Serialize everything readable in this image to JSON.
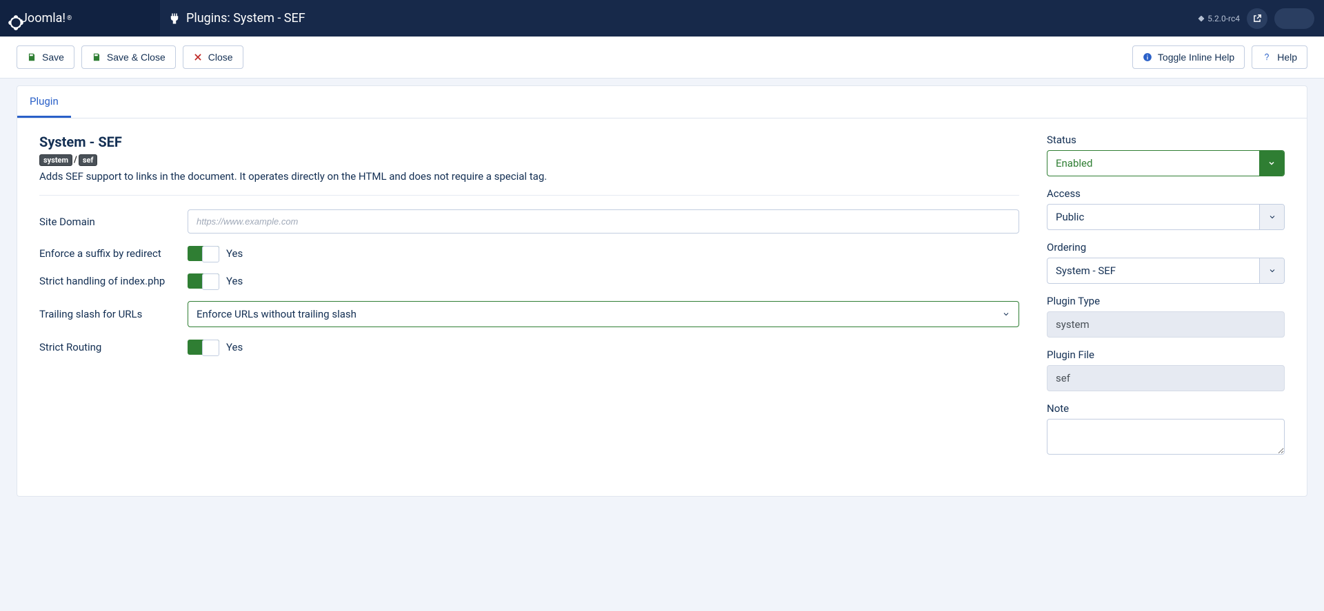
{
  "brand": "Joomla!",
  "page_title": "Plugins: System - SEF",
  "version": "5.2.0-rc4",
  "toolbar": {
    "save": "Save",
    "save_close": "Save & Close",
    "close": "Close",
    "toggle_help": "Toggle Inline Help",
    "help": "Help"
  },
  "tab": "Plugin",
  "plugin": {
    "title": "System - SEF",
    "badge_group": "system",
    "badge_element": "sef",
    "description": "Adds SEF support to links in the document. It operates directly on the HTML and does not require a special tag."
  },
  "fields": {
    "site_domain_label": "Site Domain",
    "site_domain_placeholder": "https://www.example.com",
    "site_domain_value": "",
    "enforce_suffix_label": "Enforce a suffix by redirect",
    "enforce_suffix_value": "Yes",
    "strict_index_label": "Strict handling of index.php",
    "strict_index_value": "Yes",
    "trailing_label": "Trailing slash for URLs",
    "trailing_value": "Enforce URLs without trailing slash",
    "strict_routing_label": "Strict Routing",
    "strict_routing_value": "Yes"
  },
  "side": {
    "status_label": "Status",
    "status_value": "Enabled",
    "access_label": "Access",
    "access_value": "Public",
    "ordering_label": "Ordering",
    "ordering_value": "System - SEF",
    "plugin_type_label": "Plugin Type",
    "plugin_type_value": "system",
    "plugin_file_label": "Plugin File",
    "plugin_file_value": "sef",
    "note_label": "Note",
    "note_value": ""
  }
}
